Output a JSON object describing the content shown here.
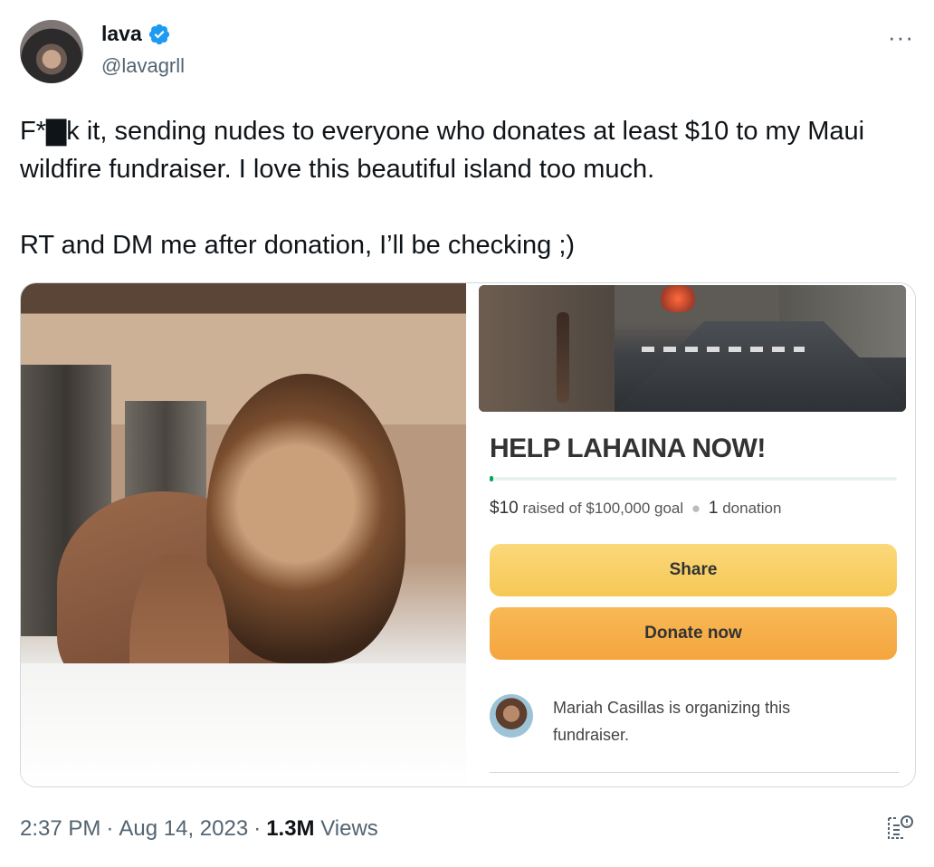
{
  "tweet": {
    "author_name": "lava",
    "author_handle": "@lavagrll",
    "verified": true,
    "text": "F*▇k it, sending nudes to everyone who donates at least $10 to my Maui wildfire fundraiser. I love this beautiful island too much.\n\nRT and DM me after donation, I’ll be checking ;)",
    "more_icon": "···",
    "time": "2:37 PM",
    "date": "Aug 14, 2023",
    "views_count": "1.3M",
    "views_label": "Views"
  },
  "fundraiser": {
    "title": "HELP LAHAINA NOW!",
    "raised_amount": "$10",
    "raised_text": "raised of $100,000 goal",
    "donation_count": "1",
    "donation_label": "donation",
    "progress_fraction": 0.0001,
    "share_label": "Share",
    "donate_label": "Donate now",
    "organizer_text": "Mariah Casillas is organizing this fundraiser."
  },
  "colors": {
    "verified_blue": "#1d9bf0",
    "progress_green": "#02a95c",
    "share_yellow": "#f6c855",
    "donate_orange": "#f5a53e"
  }
}
